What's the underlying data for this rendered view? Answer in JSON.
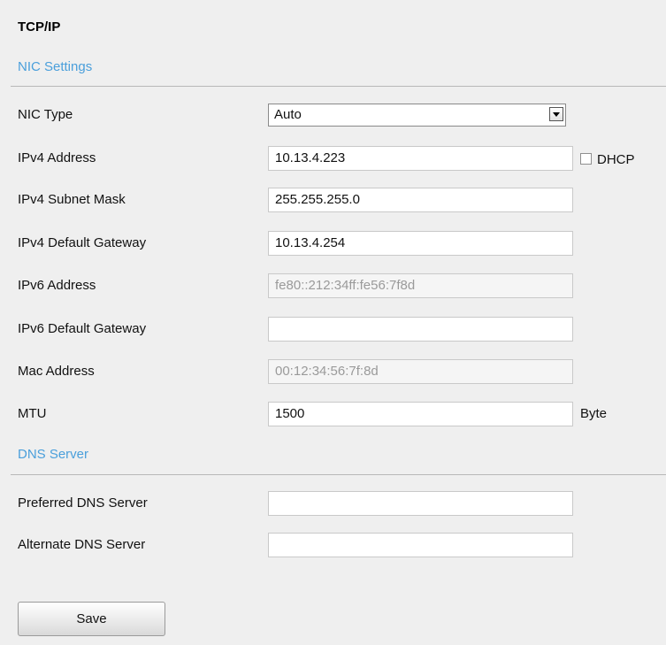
{
  "page_title": "TCP/IP",
  "nic_section": {
    "title": "NIC Settings",
    "nic_type": {
      "label": "NIC Type",
      "value": "Auto"
    },
    "ipv4_address": {
      "label": "IPv4 Address",
      "value": "10.13.4.223",
      "dhcp_label": "DHCP",
      "dhcp_checked": false
    },
    "ipv4_subnet_mask": {
      "label": "IPv4 Subnet Mask",
      "value": "255.255.255.0"
    },
    "ipv4_default_gateway": {
      "label": "IPv4 Default Gateway",
      "value": "10.13.4.254"
    },
    "ipv6_address": {
      "label": "IPv6 Address",
      "value": "fe80::212:34ff:fe56:7f8d"
    },
    "ipv6_default_gateway": {
      "label": "IPv6 Default Gateway",
      "value": ""
    },
    "mac_address": {
      "label": "Mac Address",
      "value": "00:12:34:56:7f:8d"
    },
    "mtu": {
      "label": "MTU",
      "value": "1500",
      "unit": "Byte"
    }
  },
  "dns_section": {
    "title": "DNS Server",
    "preferred": {
      "label": "Preferred DNS Server",
      "value": ""
    },
    "alternate": {
      "label": "Alternate DNS Server",
      "value": ""
    }
  },
  "actions": {
    "save_label": "Save"
  },
  "colors": {
    "section_title": "#4a9fdb",
    "background": "#efefef"
  }
}
